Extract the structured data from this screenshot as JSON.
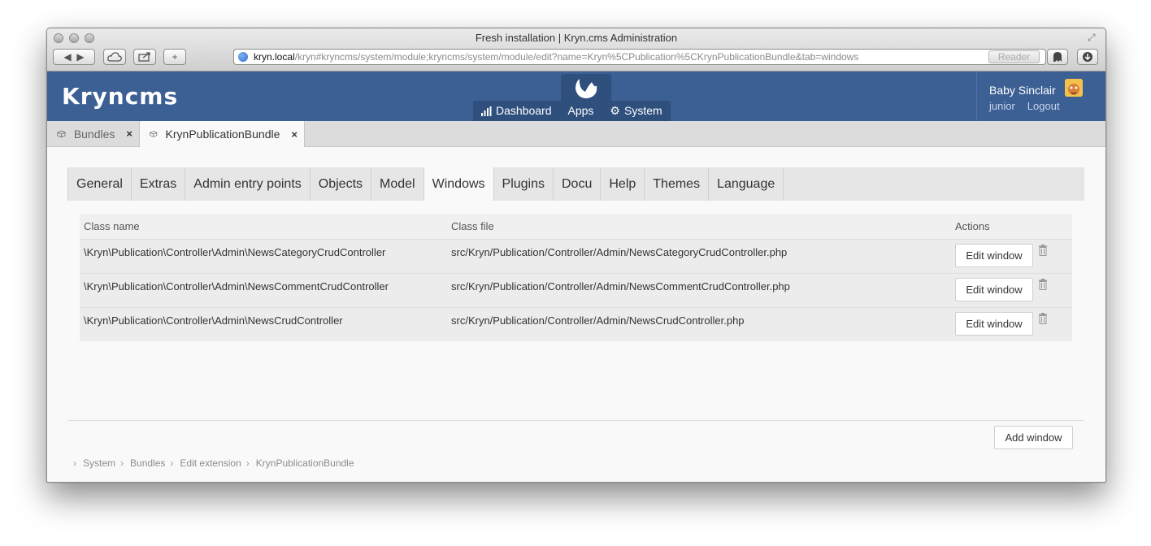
{
  "browser": {
    "window_title": "Fresh installation | Kryn.cms Administration",
    "url_host": "kryn.local",
    "url_path": "/kryn#kryncms/system/module;kryncms/system/module/edit?name=Kryn%5CPublication%5CKrynPublicationBundle&tab=windows",
    "reader_label": "Reader"
  },
  "header": {
    "logo": "Kryncms",
    "nav": [
      {
        "label": "Dashboard",
        "icon": "bar-chart-icon"
      },
      {
        "label": "Apps",
        "icon": "apps-icon"
      },
      {
        "label": "System",
        "icon": "gear-icon"
      }
    ],
    "user": {
      "name": "Baby Sinclair",
      "role": "junior",
      "logout": "Logout"
    }
  },
  "window_tabs": [
    {
      "label": "Bundles",
      "close": "×",
      "active": false
    },
    {
      "label": "KrynPublicationBundle",
      "close": "×",
      "active": true
    }
  ],
  "sub_tabs": [
    "General",
    "Extras",
    "Admin entry points",
    "Objects",
    "Model",
    "Windows",
    "Plugins",
    "Docu",
    "Help",
    "Themes",
    "Language"
  ],
  "active_sub_tab": "Windows",
  "table": {
    "columns": [
      "Class name",
      "Class file",
      "Actions"
    ],
    "rows": [
      {
        "class_name": "\\Kryn\\Publication\\Controller\\Admin\\NewsCategoryCrudController",
        "class_file": "src/Kryn/Publication/Controller/Admin/NewsCategoryCrudController.php",
        "action": "Edit window"
      },
      {
        "class_name": "\\Kryn\\Publication\\Controller\\Admin\\NewsCommentCrudController",
        "class_file": "src/Kryn/Publication/Controller/Admin/NewsCommentCrudController.php",
        "action": "Edit window"
      },
      {
        "class_name": "\\Kryn\\Publication\\Controller\\Admin\\NewsCrudController",
        "class_file": "src/Kryn/Publication/Controller/Admin/NewsCrudController.php",
        "action": "Edit window"
      }
    ]
  },
  "add_button": "Add window",
  "breadcrumb": [
    "System",
    "Bundles",
    "Edit extension",
    "KrynPublicationBundle"
  ],
  "colors": {
    "header_bg": "#3c6094",
    "header_dark": "#2f4f7d"
  }
}
